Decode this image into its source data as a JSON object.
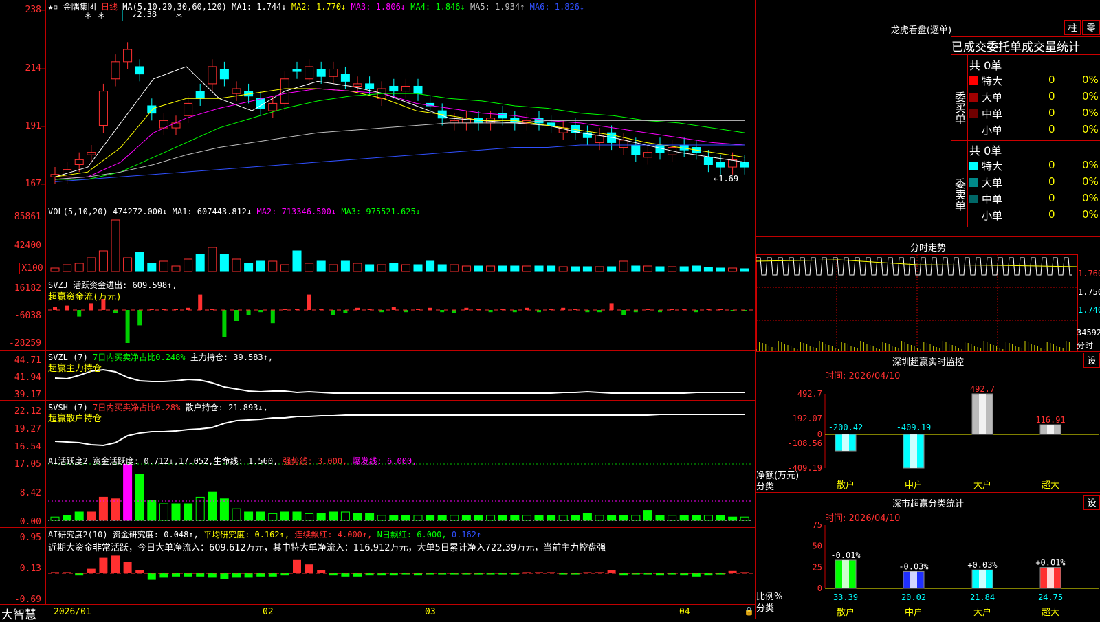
{
  "footer": {
    "brand": "大智慧",
    "dates": [
      "2026/01",
      "02",
      "03",
      "04"
    ]
  },
  "main": {
    "stock_name": "金隅集团",
    "period": "日线",
    "ma_header": "MA(5,10,20,30,60,120)",
    "ma": [
      {
        "label": "MA1:",
        "value": "1.744↓",
        "color": "#ffffff"
      },
      {
        "label": "MA2:",
        "value": "1.770↓",
        "color": "#ffff00"
      },
      {
        "label": "MA3:",
        "value": "1.806↓",
        "color": "#ff00ff"
      },
      {
        "label": "MA4:",
        "value": "1.846↓",
        "color": "#00ff00"
      },
      {
        "label": "MA5:",
        "value": "1.934↑",
        "color": "#c0c0c0"
      },
      {
        "label": "MA6:",
        "value": "1.826↓",
        "color": "#3050ff"
      }
    ],
    "y_ticks": [
      "238",
      "214",
      "191",
      "167"
    ],
    "high_note": "2.38",
    "low_note": "1.69"
  },
  "vol": {
    "header": "VOL(5,10,20)",
    "value": "474272.000↓",
    "ma1": "MA1: 607443.812↓",
    "ma2": "MA2: 713346.500↓",
    "ma3": "MA3: 975521.625↓",
    "y_ticks": [
      "85861",
      "42400"
    ],
    "unit": "X100"
  },
  "svzj": {
    "header": "SVZJ  活跃资金进出: 609.598↑,",
    "sub": "超赢资金流(万元)",
    "y_ticks": [
      "16182",
      "-6038",
      "-28259"
    ]
  },
  "svzl": {
    "header": "SVZL (7)",
    "note": "7日内买卖净占比0.248%",
    "extra": "主力持仓: 39.583↑,",
    "sub": "超赢主力持仓",
    "y_ticks": [
      "44.71",
      "41.94",
      "39.17"
    ]
  },
  "svsh": {
    "header": "SVSH (7)",
    "note": "7日内买卖净占比0.28%",
    "extra": "散户持仓: 21.893↓,",
    "sub": "超赢散户持仓",
    "y_ticks": [
      "22.12",
      "19.27",
      "16.54"
    ]
  },
  "ai1": {
    "header": "AI活跃度2 资金活跃度: 0.712↓,17.052,生命线: 1.560,",
    "strong": "强势线: 3.000,",
    "burst": "爆发线: 6.000,",
    "y_ticks": [
      "17.05",
      "8.42",
      "0.00"
    ]
  },
  "ai2": {
    "header": "AI研究度2(10) 资金研究度: 0.048↑,",
    "avg": "平均研究度: 0.162↑,",
    "red": "连续飘红: 4.000↑,",
    "nred": "N日飘红: 6.000,",
    "tail": "0.162↑",
    "msg": "近期大资金非常活跃，今日大单净流入：609.612万元，其中特大单净流入：116.912万元，大单5日累计净入722.39万元，当前主力控盘强",
    "y_ticks": [
      "0.95",
      "0.13",
      "-0.69"
    ]
  },
  "lhb": {
    "title": "龙虎看盘(逐单)",
    "btn1": "柱",
    "btn2": "零",
    "subtitle": "已成交委托单成交量统计",
    "buy": {
      "side": "委买单",
      "total": "共 0单",
      "rows": [
        {
          "name": "特大",
          "count": "0",
          "pct": "0%",
          "color": "#ff0000"
        },
        {
          "name": "大单",
          "count": "0",
          "pct": "0%",
          "color": "#a00000"
        },
        {
          "name": "中单",
          "count": "0",
          "pct": "0%",
          "color": "#700000"
        },
        {
          "name": "小单",
          "count": "0",
          "pct": "0%",
          "color": ""
        }
      ]
    },
    "sell": {
      "side": "委卖单",
      "total": "共 0单",
      "rows": [
        {
          "name": "特大",
          "count": "0",
          "pct": "0%",
          "color": "#00ffff"
        },
        {
          "name": "大单",
          "count": "0",
          "pct": "0%",
          "color": "#008888"
        },
        {
          "name": "中单",
          "count": "0",
          "pct": "0%",
          "color": "#006666"
        },
        {
          "name": "小单",
          "count": "0",
          "pct": "0%",
          "color": ""
        }
      ]
    }
  },
  "fenshi": {
    "title": "分时走势",
    "y_ticks": [
      "1.760",
      "1.750",
      "1.740"
    ],
    "vol_tick": "34592",
    "vol_unit": "分时"
  },
  "sz_monitor": {
    "title": "深圳超赢实时监控",
    "btn": "设",
    "date": "时间: 2026/04/10",
    "y_label": "净额(万元)",
    "x_label": "分类"
  },
  "sz_class": {
    "title": "深市超赢分类统计",
    "btn": "设",
    "date": "时间: 2026/04/10",
    "y_label": "比例%",
    "x_label": "分类"
  },
  "chart_data": [
    {
      "type": "bar",
      "title": "深圳超赢实时监控",
      "categories": [
        "散户",
        "中户",
        "大户",
        "超大"
      ],
      "values": [
        -200.42,
        -409.19,
        492.7,
        116.91
      ],
      "ylabel": "净额(万元)",
      "y_ticks": [
        492.7,
        192.07,
        0,
        -108.56,
        -409.19
      ],
      "ylim": [
        -409.19,
        492.7
      ]
    },
    {
      "type": "bar",
      "title": "深市超赢分类统计",
      "categories": [
        "散户",
        "中户",
        "大户",
        "超大"
      ],
      "values": [
        33.39,
        20.02,
        21.84,
        24.75
      ],
      "changes": [
        "-0.01%",
        "-0.03%",
        "+0.03%",
        "+0.01%"
      ],
      "ylabel": "比例%",
      "y_ticks": [
        75,
        50,
        25,
        0
      ],
      "ylim": [
        0,
        75
      ]
    }
  ]
}
